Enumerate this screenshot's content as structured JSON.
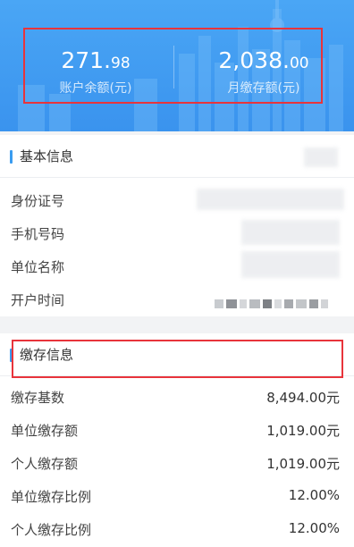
{
  "account": {
    "balance_int": "271.",
    "balance_dec": "98",
    "balance_caption": "账户余额(元)",
    "monthly_int": "2,038.",
    "monthly_dec": "00",
    "monthly_caption": "月缴存额(元)"
  },
  "basic_info": {
    "title": "基本信息",
    "rows": [
      {
        "label": "身份证号"
      },
      {
        "label": "手机号码"
      },
      {
        "label": "单位名称"
      },
      {
        "label": "开户时间"
      }
    ]
  },
  "payment_info": {
    "title": "缴存信息",
    "rows": [
      {
        "label": "缴存基数",
        "value": "8,494.00元"
      },
      {
        "label": "单位缴存额",
        "value": "1,019.00元"
      },
      {
        "label": "个人缴存额",
        "value": "1,019.00元"
      },
      {
        "label": "单位缴存比例",
        "value": "12.00%"
      },
      {
        "label": "个人缴存比例",
        "value": "12.00%"
      }
    ]
  },
  "colors": {
    "header_blue": "#3a93ee",
    "accent_bar": "#3a9cf0",
    "highlight_red": "#e8343b"
  }
}
